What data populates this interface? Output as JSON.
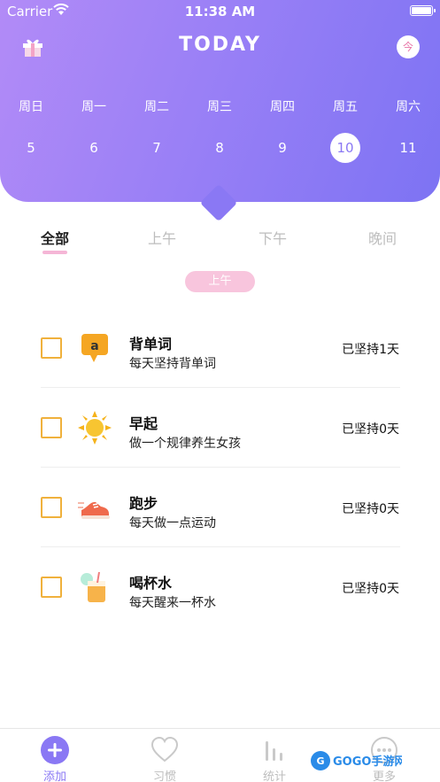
{
  "status": {
    "carrier": "Carrier",
    "time": "11:38 AM"
  },
  "header": {
    "title": "TODAY",
    "today_button": "今"
  },
  "week": [
    {
      "weekday": "周日",
      "date": "5",
      "selected": false
    },
    {
      "weekday": "周一",
      "date": "6",
      "selected": false
    },
    {
      "weekday": "周二",
      "date": "7",
      "selected": false
    },
    {
      "weekday": "周三",
      "date": "8",
      "selected": false
    },
    {
      "weekday": "周四",
      "date": "9",
      "selected": false
    },
    {
      "weekday": "周五",
      "date": "10",
      "selected": true
    },
    {
      "weekday": "周六",
      "date": "11",
      "selected": false
    }
  ],
  "tabs": [
    {
      "label": "全部",
      "active": true
    },
    {
      "label": "上午",
      "active": false
    },
    {
      "label": "下午",
      "active": false
    },
    {
      "label": "晚间",
      "active": false
    }
  ],
  "section_label": "上午",
  "habits": [
    {
      "name": "背单词",
      "desc": "每天坚持背单词",
      "days": "已坚持1天",
      "icon": "amazon-chat-icon"
    },
    {
      "name": "早起",
      "desc": "做一个规律养生女孩",
      "days": "已坚持0天",
      "icon": "sun-icon"
    },
    {
      "name": "跑步",
      "desc": "每天做一点运动",
      "days": "已坚持0天",
      "icon": "sneaker-icon"
    },
    {
      "name": "喝杯水",
      "desc": "每天醒来一杯水",
      "days": "已坚持0天",
      "icon": "drink-cup-icon"
    }
  ],
  "tabbar": [
    {
      "label": "添加",
      "icon": "add-icon",
      "active": true
    },
    {
      "label": "习惯",
      "icon": "heart-icon",
      "active": false
    },
    {
      "label": "统计",
      "icon": "stats-icon",
      "active": false
    },
    {
      "label": "更多",
      "icon": "more-icon",
      "active": false
    }
  ],
  "watermark": "GOGO手游网",
  "colors": {
    "accent": "#8a78f4",
    "checkbox": "#f0b13c",
    "pill": "#f8c5dd"
  }
}
